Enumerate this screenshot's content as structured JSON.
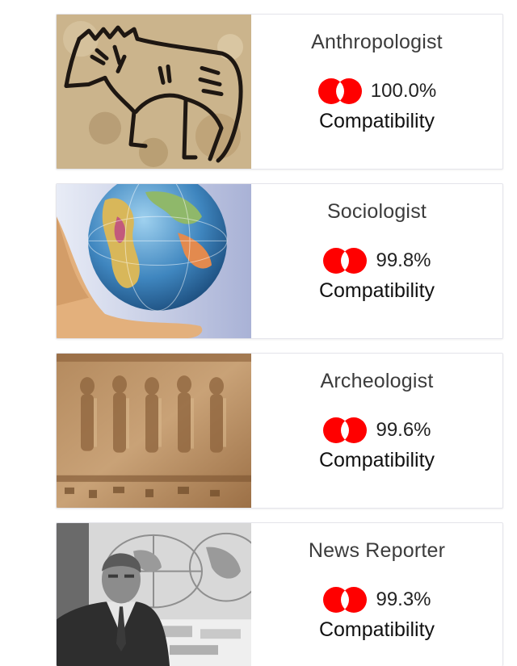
{
  "colors": {
    "match_icon": "#ff0000",
    "card_border": "#e4e4ea",
    "title": "#3c3c3c"
  },
  "results": [
    {
      "title": "Anthropologist",
      "percent": "100.0%",
      "subtitle": "Compatibility",
      "icon": "match-icon"
    },
    {
      "title": "Sociologist",
      "percent": "99.8%",
      "subtitle": "Compatibility",
      "icon": "match-icon"
    },
    {
      "title": "Archeologist",
      "percent": "99.6%",
      "subtitle": "Compatibility",
      "icon": "match-icon"
    },
    {
      "title": "News Reporter",
      "percent": "99.3%",
      "subtitle": "Compatibility",
      "icon": "match-icon"
    }
  ]
}
